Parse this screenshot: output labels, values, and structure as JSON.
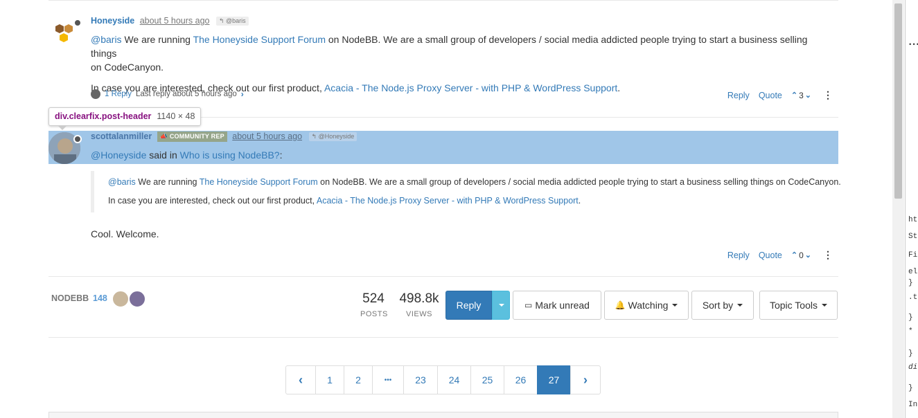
{
  "post1": {
    "username": "Honeyside",
    "timeago": "about 5 hours ago",
    "reply_to": "@baris",
    "line1": {
      "mention": "@baris",
      "t1": " We are running ",
      "link": "The Honeyside Support Forum",
      "t2": " on NodeBB. We are a small group of developers / social media addicted people trying to start a business selling things"
    },
    "line2": "on CodeCanyon.",
    "line3": {
      "t1": "In case you are interested, check out our first product, ",
      "link": "Acacia - The Node.js Proxy Server - with PHP & WordPress Support",
      "t2": "."
    },
    "replies_label": "1 Reply",
    "last_reply": "Last reply about 5 hours ago",
    "reply": "Reply",
    "quote": "Quote",
    "votes": "3"
  },
  "tooltip": {
    "selector": "div.clearfix.post-header",
    "dims": "1140 × 48"
  },
  "post2": {
    "username": "scottalanmiller",
    "badge": "COMMUNITY REP",
    "timeago": "about 5 hours ago",
    "reply_to": "@Honeyside",
    "said_user": "@Honeyside",
    "said_in": " said in ",
    "topic_link": "Who is using NodeBB?",
    "colon": ":",
    "quote_line1": {
      "mention": "@baris",
      "t1": " We are running ",
      "link": "The Honeyside Support Forum",
      "t2": " on NodeBB. We are a small group of developers / social media addicted people trying to start a business selling things on CodeCanyon."
    },
    "quote_line2": {
      "t1": "In case you are interested, check out our first product, ",
      "link": "Acacia - The Node.js Proxy Server - with PHP & WordPress Support",
      "t2": "."
    },
    "body": "Cool. Welcome.",
    "reply": "Reply",
    "quote": "Quote",
    "votes": "0"
  },
  "topic_bar": {
    "category": "NODEBB",
    "count": "148",
    "posts_num": "524",
    "posts_lbl": "POSTS",
    "views_num": "498.8k",
    "views_lbl": "VIEWS",
    "reply_btn": "Reply",
    "mark_unread": "Mark unread",
    "watching": "Watching",
    "sort_by": "Sort by",
    "topic_tools": "Topic Tools"
  },
  "pagination": {
    "pages": [
      "1",
      "2",
      "•••",
      "23",
      "24",
      "25",
      "26",
      "27"
    ],
    "active": "27"
  },
  "devtools": {
    "dots": "•••",
    "lines": [
      "ht",
      "St",
      "Fil",
      "el",
      "}",
      ".t",
      "}",
      "*",
      "}",
      "di",
      "}",
      "Inh"
    ]
  },
  "colors": {
    "link": "#337ab7",
    "highlight": "#9fc5e8",
    "primary": "#337ab7",
    "caret_btn": "#5bc0de"
  }
}
